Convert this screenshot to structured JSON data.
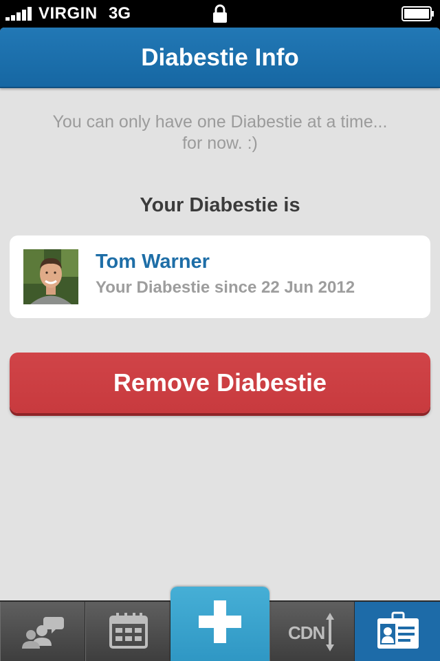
{
  "status_bar": {
    "carrier": "VIRGIN",
    "network": "3G",
    "icons": [
      "signal-icon",
      "lock-icon",
      "battery-icon"
    ]
  },
  "nav": {
    "title": "Diabestie Info"
  },
  "content": {
    "notice": "You can only have one Diabestie at a time... for now.  :)",
    "section_label": "Your Diabestie is",
    "diabestie": {
      "name": "Tom Warner",
      "since": "Your Diabestie since 22 Jun 2012"
    },
    "remove_label": "Remove Diabestie"
  },
  "tab_bar": {
    "tabs": [
      {
        "icon": "community-icon"
      },
      {
        "icon": "calendar-icon"
      },
      {
        "icon": "add-plus-icon"
      },
      {
        "icon": "cdn-icon",
        "label": "CDN"
      },
      {
        "icon": "id-card-icon"
      }
    ],
    "active_index": 4
  },
  "colors": {
    "nav_blue": "#1a6fac",
    "name_blue": "#1e6ea7",
    "remove_red": "#c83a3e",
    "center_tab": "#3ba4cf",
    "background": "#e2e2e2"
  }
}
